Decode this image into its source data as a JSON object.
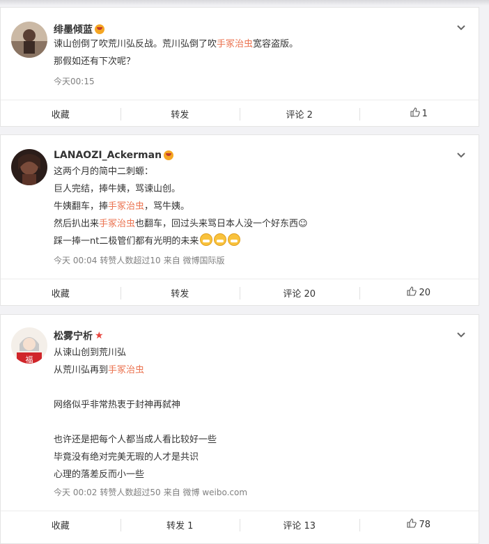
{
  "posts": [
    {
      "username": "绯墨倾蓝",
      "lines": [
        [
          {
            "t": "谏山创倒了吹荒川弘反战。荒川弘倒了吹"
          },
          {
            "t": "手冢治虫",
            "hl": true
          },
          {
            "t": "宽容盗版。"
          }
        ],
        [
          {
            "t": "那假如还有下次呢？"
          }
        ]
      ],
      "meta": [
        "今天00:15"
      ],
      "actions": {
        "fav": "收藏",
        "repost": "转发",
        "comment": "评论 2",
        "like": "1"
      }
    },
    {
      "username": "LANAOZI_Ackerman",
      "lines": [
        [
          {
            "t": "这两个月的简中二刺螈："
          }
        ],
        [
          {
            "t": "巨人完结，捧牛姨，骂谏山创。"
          }
        ],
        [
          {
            "t": "牛姨翻车，捧"
          },
          {
            "t": "手冢治虫",
            "hl": true
          },
          {
            "t": "，骂牛姨。"
          }
        ],
        [
          {
            "t": "然后扒出来"
          },
          {
            "t": "手冢治虫",
            "hl": true
          },
          {
            "t": "也翻车，回过头来骂日本人没一个好东西☺"
          }
        ],
        [
          {
            "t": "踩一捧一nt二极管们都有光明的未来"
          },
          {
            "emoji": true
          },
          {
            "emoji": true
          },
          {
            "emoji": true
          }
        ]
      ],
      "meta": [
        "今天 00:04",
        "转赞人数超过10",
        "来自 微博国际版"
      ],
      "actions": {
        "fav": "收藏",
        "repost": "转发",
        "comment": "评论 20",
        "like": "20"
      }
    },
    {
      "username": "松雾宁析",
      "lines": [
        [
          {
            "t": "从谏山创到荒川弘"
          }
        ],
        [
          {
            "t": "从荒川弘再到"
          },
          {
            "t": "手冢治虫",
            "hl": true
          }
        ],
        [
          {
            "t": ""
          }
        ],
        [
          {
            "t": "网络似乎非常热衷于封神再弑神"
          }
        ],
        [
          {
            "t": ""
          }
        ],
        [
          {
            "t": "也许还是把每个人都当成人看比较好一些"
          }
        ],
        [
          {
            "t": "毕竟没有绝对完美无瑕的人才是共识"
          }
        ],
        [
          {
            "t": "心理的落差反而小一些"
          }
        ]
      ],
      "meta": [
        "今天 00:02",
        "转赞人数超过50",
        "来自 微博 weibo.com"
      ],
      "actions": {
        "fav": "收藏",
        "repost": "转发 1",
        "comment": "评论 13",
        "like": "78"
      }
    }
  ],
  "icons": {
    "chevron": "chevron-down-icon",
    "like": "thumbs-up-icon",
    "vip": "vip-badge-icon",
    "star": "star-badge-icon"
  },
  "colors": {
    "highlight": "#eb7350",
    "meta": "#808080"
  }
}
